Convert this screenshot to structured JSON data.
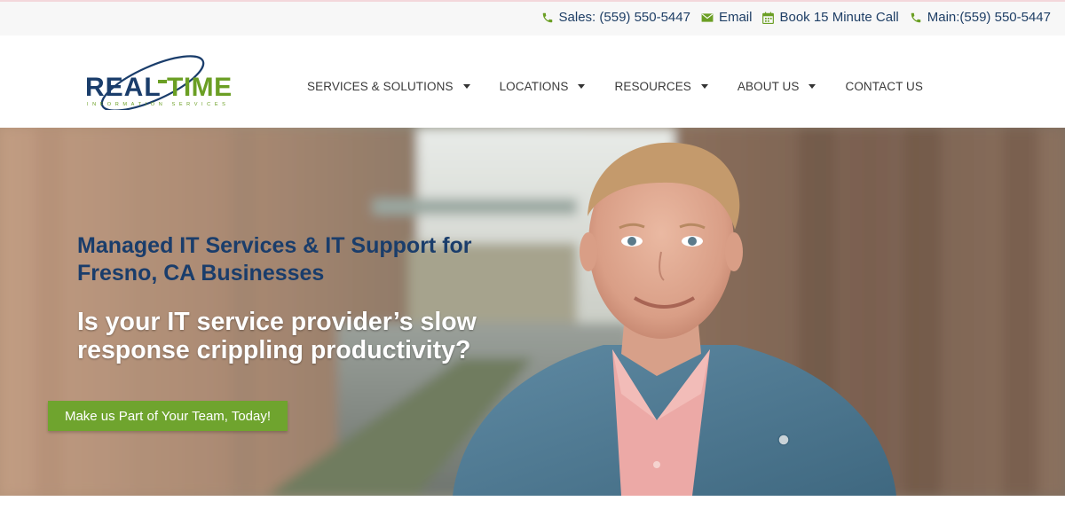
{
  "topbar": {
    "sales": {
      "label": "Sales: (559) 550-5447",
      "icon": "phone-icon"
    },
    "email": {
      "label": "Email",
      "icon": "envelope-icon"
    },
    "book": {
      "label": "Book 15 Minute Call",
      "icon": "calendar-icon"
    },
    "main": {
      "label": "Main:(559) 550-5447",
      "icon": "phone-icon"
    }
  },
  "logo": {
    "word_left": "REAL",
    "word_right": "TIME",
    "tagline": "INFORMATION SERVICES"
  },
  "nav": {
    "items": [
      {
        "label": "SERVICES & SOLUTIONS",
        "has_dropdown": true
      },
      {
        "label": "LOCATIONS",
        "has_dropdown": true
      },
      {
        "label": "RESOURCES",
        "has_dropdown": true
      },
      {
        "label": "ABOUT US",
        "has_dropdown": true
      },
      {
        "label": "CONTACT US",
        "has_dropdown": false
      }
    ]
  },
  "hero": {
    "heading": "Managed IT Services & IT Support for Fresno, CA Businesses",
    "subheading": "Is your IT service provider’s slow response crippling productivity?",
    "cta_label": "Make us Part of Your Team, Today!"
  },
  "colors": {
    "navy": "#1a3d6b",
    "accent_green": "#6fa42e",
    "icon_green": "#6b9f24"
  }
}
